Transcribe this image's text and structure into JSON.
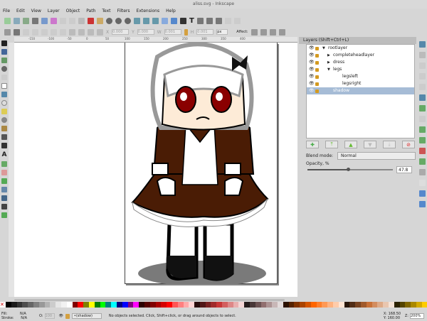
{
  "window": {
    "title": "aliss.svg - Inkscape"
  },
  "menu": [
    "File",
    "Edit",
    "View",
    "Layer",
    "Object",
    "Path",
    "Text",
    "Filters",
    "Extensions",
    "Help"
  ],
  "toolcontrols": {
    "x_label": "X",
    "x": "0.000",
    "y_label": "Y",
    "y": "0.000",
    "w_label": "W",
    "w": "0.001",
    "h_label": "H",
    "h": "0.001",
    "unit": "px",
    "affect": "Affect:"
  },
  "ruler": [
    "-150",
    "-100",
    "-50",
    "0",
    "50",
    "100",
    "150",
    "200",
    "250",
    "300",
    "350",
    "400"
  ],
  "layers_panel": {
    "title": "Layers (Shift+Ctrl+L)",
    "layers": [
      {
        "name": "rootlayer",
        "indent": 0,
        "arrow": "▼"
      },
      {
        "name": "completeheadlayer",
        "indent": 1,
        "arrow": "▶"
      },
      {
        "name": "dress",
        "indent": 1,
        "arrow": "▶"
      },
      {
        "name": "legs",
        "indent": 1,
        "arrow": "▼"
      },
      {
        "name": "legsleft",
        "indent": 2,
        "arrow": ""
      },
      {
        "name": "legsright",
        "indent": 2,
        "arrow": ""
      },
      {
        "name": "shadow",
        "indent": 1,
        "arrow": "",
        "selected": true
      }
    ],
    "blend_label": "Blend mode:",
    "blend_value": "Normal",
    "opacity_label": "Opacity, %",
    "opacity": 47.8,
    "opacity_text": "47.8"
  },
  "palette": [
    "#000000",
    "#1a1a1a",
    "#333333",
    "#4d4d4d",
    "#666666",
    "#808080",
    "#999999",
    "#b3b3b3",
    "#cccccc",
    "#e6e6e6",
    "#f2f2f2",
    "#ffffff",
    "#800000",
    "#ff0000",
    "#808000",
    "#ffff00",
    "#008000",
    "#00ff00",
    "#008080",
    "#00ffff",
    "#000080",
    "#0000ff",
    "#800080",
    "#ff00ff",
    "#2b0000",
    "#550000",
    "#800000",
    "#aa0000",
    "#d40000",
    "#ff0000",
    "#ff5555",
    "#ff8080",
    "#ffaaaa",
    "#ffd5d5",
    "#280b0b",
    "#501616",
    "#782121",
    "#a02c2c",
    "#c83737",
    "#d35f5f",
    "#de8787",
    "#e9afaf",
    "#f4d7d7",
    "#241c1c",
    "#483737",
    "#6c5353",
    "#916f6f",
    "#ac9393",
    "#c8b7b7",
    "#e3dbdb",
    "#2b1100",
    "#552200",
    "#803300",
    "#aa4400",
    "#d45500",
    "#ff6600",
    "#ff7f2a",
    "#ff9955",
    "#ffb380",
    "#ffccaa",
    "#ffe6d5",
    "#28170b",
    "#502d16",
    "#784421",
    "#a05a2c",
    "#c87137",
    "#d38d5f",
    "#deaa87",
    "#e9c6af",
    "#f4e3d7",
    "#2b2200",
    "#554400",
    "#806600",
    "#aa8800",
    "#d4aa00",
    "#ffcc00"
  ],
  "status": {
    "fill_label": "Fill:",
    "fill": "N/A",
    "stroke_label": "Stroke:",
    "stroke": "N/A",
    "o_label": "O:",
    "o": "100",
    "layer": "•(shadow)",
    "message": "No objects selected. Click, Shift+click, or drag around objects to select.",
    "x_label": "X:",
    "x": "168.50",
    "y_label": "Y:",
    "y": "160.00",
    "z_label": "Z:",
    "zoom": "200%"
  }
}
